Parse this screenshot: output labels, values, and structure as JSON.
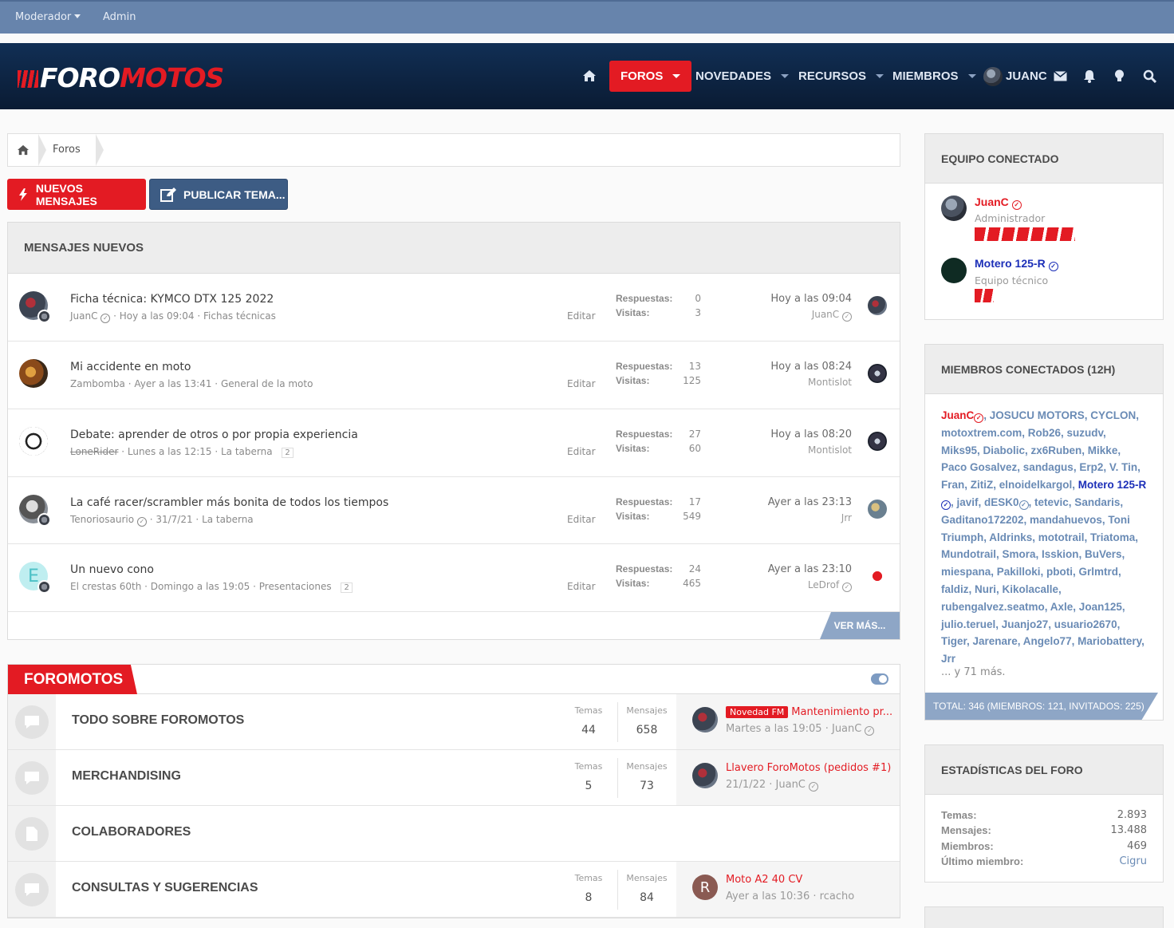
{
  "staff_bar": {
    "moderator": "Moderador",
    "admin": "Admin"
  },
  "logo": {
    "part1": "FORO",
    "part2": "MOTOS"
  },
  "nav": {
    "forums": "FOROS",
    "whats_new": "NOVEDADES",
    "resources": "RECURSOS",
    "members": "MIEMBROS",
    "user": "JUANC"
  },
  "breadcrumb": {
    "forums": "Foros"
  },
  "buttons": {
    "new_posts": "NUEVOS MENSAJES",
    "post_thread": "PUBLICAR TEMA..."
  },
  "new_posts": {
    "title": "MENSAJES NUEVOS",
    "replies_label": "Respuestas:",
    "views_label": "Visitas:",
    "edit_label": "Editar",
    "see_more": "VER MÁS...",
    "threads": [
      {
        "title": "Ficha técnica: KYMCO DTX 125 2022",
        "author": "JuanC",
        "date": "Hoy a las 09:04",
        "forum": "Fichas técnicas",
        "pages": "",
        "replies": "0",
        "views": "3",
        "last_date": "Hoy a las 09:04",
        "last_user": "JuanC"
      },
      {
        "title": "Mi accidente en moto",
        "author": "Zambomba",
        "date": "Ayer a las 13:41",
        "forum": "General de la moto",
        "pages": "",
        "replies": "13",
        "views": "125",
        "last_date": "Hoy a las 08:24",
        "last_user": "Montislot"
      },
      {
        "title": "Debate: aprender de otros o por propia experiencia",
        "author": "LoneRider",
        "date": "Lunes a las 12:15",
        "forum": "La taberna",
        "pages": "2",
        "replies": "27",
        "views": "60",
        "last_date": "Hoy a las 08:20",
        "last_user": "Montislot"
      },
      {
        "title": "La café racer/scrambler más bonita de todos los tiempos",
        "author": "Tenoriosaurio",
        "date": "31/7/21",
        "forum": "La taberna",
        "pages": "",
        "replies": "17",
        "views": "549",
        "last_date": "Ayer a las 23:13",
        "last_user": "Jrr"
      },
      {
        "title": "Un nuevo cono",
        "author": "El crestas 60th",
        "date": "Domingo a las 19:05",
        "forum": "Presentaciones",
        "pages": "2",
        "replies": "24",
        "views": "465",
        "last_date": "Ayer a las 23:10",
        "last_user": "LeDrof"
      }
    ]
  },
  "category": {
    "title": "FOROMOTOS",
    "threads_label": "Temas",
    "messages_label": "Mensajes",
    "forums": [
      {
        "name": "TODO SOBRE FOROMOTOS",
        "threads": "44",
        "messages": "658",
        "last_tag": "Novedad FM",
        "last_title": "Mantenimiento pr...",
        "last_date": "Martes a las 19:05",
        "last_user": "JuanC"
      },
      {
        "name": "MERCHANDISING",
        "threads": "5",
        "messages": "73",
        "last_tag": "",
        "last_title": "Llavero ForoMotos (pedidos #1)",
        "last_date": "21/1/22",
        "last_user": "JuanC"
      },
      {
        "name": "COLABORADORES",
        "threads": "",
        "messages": "",
        "last_tag": "",
        "last_title": "",
        "last_date": "",
        "last_user": ""
      },
      {
        "name": "CONSULTAS Y SUGERENCIAS",
        "threads": "8",
        "messages": "84",
        "last_tag": "",
        "last_title": "Moto A2 40 CV",
        "last_date": "Ayer a las 10:36",
        "last_user": "rcacho",
        "avatar_letter": "R"
      }
    ]
  },
  "staff_online": {
    "title": "EQUIPO CONECTADO",
    "members": [
      {
        "name": "JuanC",
        "role": "Administrador"
      },
      {
        "name": "Motero 125-R",
        "role": "Equipo técnico"
      }
    ]
  },
  "members_online": {
    "title": "MIEMBROS CONECTADOS (12H)",
    "list_a": "JuanC",
    "list_b": ", JOSUCU MOTORS, CYCLON, motoxtrem.com, Rob26, suzudv, Miks95, Diabolic, zx6Ruben, Mikke, Paco Gosalvez, sandagus, Erp2, V. Tin, Fran, ZitiZ, elnoidelkargol, ",
    "list_c": "Motero 125-R",
    "list_d": ", javif, dESK0",
    "list_e": ", tetevic, Sandaris, Gaditano172202, mandahuevos, Toni Triumph, Aldrinks, mototrail, Triatoma, Mundotrail, Smora, Isskion, BuVers, miespana, Pakilloki, pboti, Grlmtrd, faldiz, Nuri, Kikolacalle, rubengalvez.seatmo, Axle, Joan125, julio.teruel, Juanjo27, usuario2670, Tiger, Jarenare, Angelo77, Mariobattery, Jrr",
    "more": "... y 71 más.",
    "total": "TOTAL: 346 (MIEMBROS: 121, INVITADOS: 225)"
  },
  "forum_stats": {
    "title": "ESTADÍSTICAS DEL FORO",
    "threads_label": "Temas:",
    "threads": "2.893",
    "messages_label": "Mensajes:",
    "messages": "13.488",
    "members_label": "Miembros:",
    "members": "469",
    "latest_label": "Último miembro:",
    "latest": "Cigru"
  },
  "colors": {
    "brand_red": "#e31b23",
    "header_dark": "#0a1b33",
    "staff_blue": "#6784ac",
    "link_blue": "#6a8bb5"
  }
}
